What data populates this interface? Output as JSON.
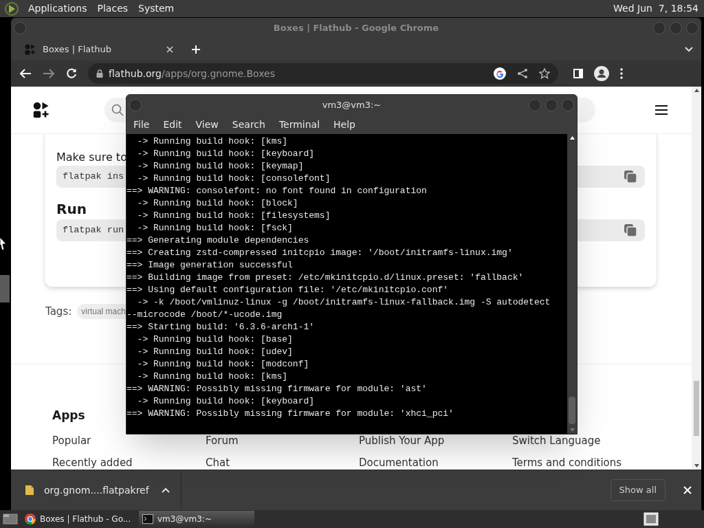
{
  "top_panel": {
    "menus": [
      "Applications",
      "Places",
      "System"
    ],
    "clock": "Wed Jun  7, 18:54"
  },
  "browser": {
    "title": "Boxes | Flathub - Google Chrome",
    "tabs": [
      {
        "label": "Boxes | Flathub",
        "selected": true
      }
    ],
    "url": {
      "host": "flathub.org",
      "path": "/apps/org.gnome.Boxes"
    },
    "page": {
      "intro": "Make sure to",
      "code_blocks": [
        "flatpak ins",
        "flatpak run"
      ],
      "run_heading": "Run",
      "tags_label": "Tags:",
      "tags": [
        "virtual mach"
      ],
      "footer": {
        "heading": "Apps",
        "columns": [
          [
            "Popular",
            "Recently added"
          ],
          [
            "Forum",
            "Chat"
          ],
          [
            "Publish Your App",
            "Documentation"
          ],
          [
            "Switch Language",
            "Terms and conditions"
          ]
        ]
      }
    },
    "download_bar": {
      "file": "org.gnom....flatpakref",
      "show_all": "Show all"
    }
  },
  "terminal": {
    "title": "vm3@vm3:~",
    "menu": [
      "File",
      "Edit",
      "View",
      "Search",
      "Terminal",
      "Help"
    ],
    "lines": [
      "  -> Running build hook: [kms]",
      "  -> Running build hook: [keyboard]",
      "  -> Running build hook: [keymap]",
      "  -> Running build hook: [consolefont]",
      "==> WARNING: consolefont: no font found in configuration",
      "  -> Running build hook: [block]",
      "  -> Running build hook: [filesystems]",
      "  -> Running build hook: [fsck]",
      "==> Generating module dependencies",
      "==> Creating zstd-compressed initcpio image: '/boot/initramfs-linux.img'",
      "==> Image generation successful",
      "==> Building image from preset: /etc/mkinitcpio.d/linux.preset: 'fallback'",
      "==> Using default configuration file: '/etc/mkinitcpio.conf'",
      "  -> -k /boot/vmlinuz-linux -g /boot/initramfs-linux-fallback.img -S autodetect",
      "--microcode /boot/*-ucode.img",
      "==> Starting build: '6.3.6-arch1-1'",
      "  -> Running build hook: [base]",
      "  -> Running build hook: [udev]",
      "  -> Running build hook: [modconf]",
      "  -> Running build hook: [kms]",
      "==> WARNING: Possibly missing firmware for module: 'ast'",
      "  -> Running build hook: [keyboard]",
      "==> WARNING: Possibly missing firmware for module: 'xhci_pci'"
    ]
  },
  "taskbar": {
    "items": [
      {
        "kind": "browser",
        "label": "Boxes | Flathub - Go...",
        "selected": false
      },
      {
        "kind": "terminal",
        "label": "vm3@vm3:~",
        "selected": true
      }
    ]
  }
}
